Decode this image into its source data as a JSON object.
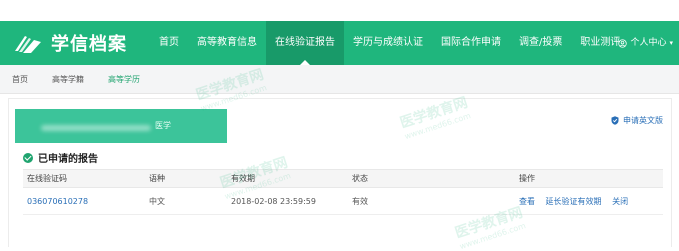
{
  "brand": {
    "name": "学信档案",
    "color": "#1fb67d"
  },
  "nav": {
    "items": [
      {
        "label": "首页",
        "active": false
      },
      {
        "label": "高等教育信息",
        "active": false
      },
      {
        "label": "在线验证报告",
        "active": true
      },
      {
        "label": "学历与成绩认证",
        "active": false
      },
      {
        "label": "国际合作申请",
        "active": false
      },
      {
        "label": "调查/投票",
        "active": false
      },
      {
        "label": "职业测评",
        "active": false
      }
    ],
    "user_center": "个人中心",
    "user_icon": "user-circle-icon"
  },
  "subnav": {
    "items": [
      {
        "label": "首页",
        "active": false
      },
      {
        "label": "高等学籍",
        "active": false
      },
      {
        "label": "高等学历",
        "active": true
      }
    ]
  },
  "report": {
    "name_suffix": "医学",
    "apply_english": "申请英文版",
    "section_title": "已申请的报告",
    "table": {
      "headers": [
        "在线验证码",
        "语种",
        "有效期",
        "状态",
        "操作"
      ],
      "rows": [
        {
          "code": "036070610278",
          "language": "中文",
          "validity": "2018-02-08 23:59:59",
          "status": "有效",
          "actions": [
            "查看",
            "延长验证有效期",
            "关闭"
          ]
        }
      ]
    }
  },
  "watermark": {
    "cn": "医学教育网",
    "url": "www.med66.com"
  }
}
